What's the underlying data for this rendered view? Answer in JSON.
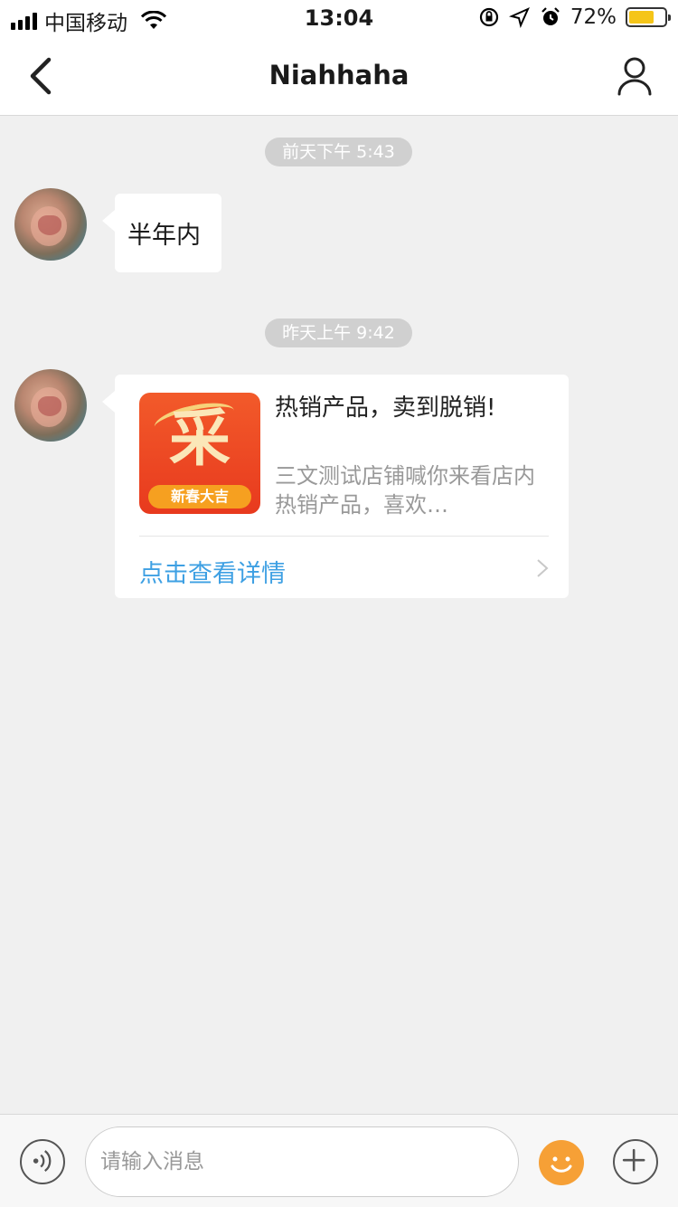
{
  "status_bar": {
    "carrier": "中国移动",
    "time": "13:04",
    "battery_percent": "72%",
    "battery_level": 0.72,
    "battery_color": "#f5c518"
  },
  "nav": {
    "title": "Niahhaha",
    "back_icon": "chevron-left-icon",
    "profile_icon": "person-icon"
  },
  "messages": [
    {
      "timestamp": "前天下午 5:43",
      "type": "text",
      "text": "半年内"
    },
    {
      "timestamp": "昨天上午 9:42",
      "type": "card",
      "thumbnail_text": "采",
      "thumbnail_ribbon": "新春大吉",
      "title": "热销产品，卖到脱销!",
      "description": "三文测试店铺喊你来看店内热销产品，喜欢…",
      "link": "点击查看详情"
    }
  ],
  "input_bar": {
    "placeholder": "请输入消息",
    "voice_icon": "voice-icon",
    "emoji_icon": "smiley-icon",
    "plus_icon": "plus-icon"
  },
  "colors": {
    "accent_link": "#3ea0e3",
    "emoji": "#f6a036",
    "background": "#f0f0f0"
  }
}
